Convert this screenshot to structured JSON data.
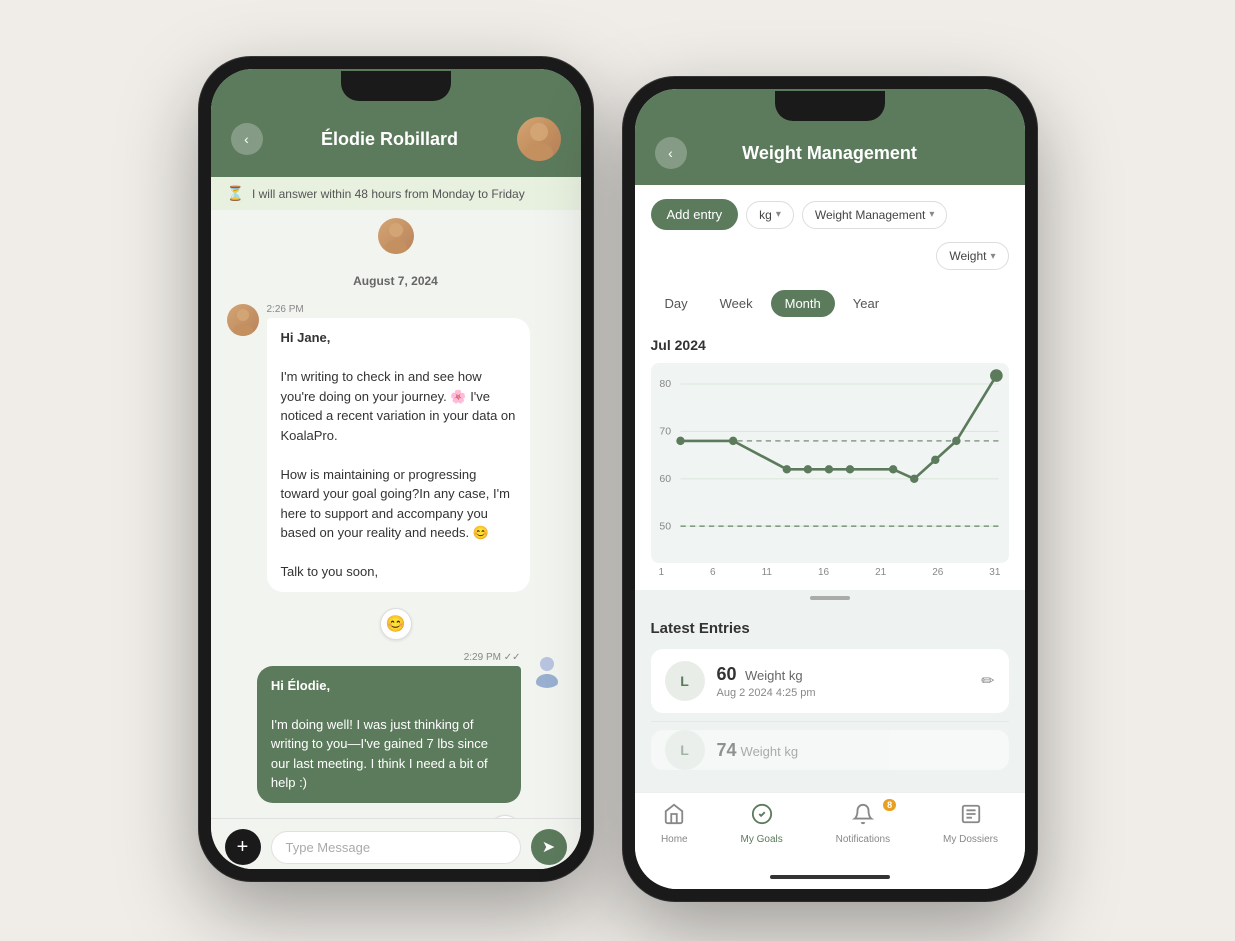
{
  "phone1": {
    "header": {
      "name": "Élodie Robillard",
      "back_label": "‹"
    },
    "status_bar": {
      "text": "I will answer within 48 hours from Monday to Friday"
    },
    "date_label": "August 7, 2024",
    "messages": [
      {
        "type": "received",
        "time": "2:26 PM",
        "text": "Hi Jane,\n\nI'm writing to check in and see how you're doing on your journey. 🌸 I've noticed a recent variation in your data on KoalaPro.\n\nHow is maintaining or progressing toward your goal going?In any case, I'm here to support and accompany you based on your reality and needs. 😊\n\nTalk to you soon,"
      },
      {
        "type": "sent",
        "time": "2:29 PM",
        "text": "Hi Élodie,\n\nI'm doing well! I was just thinking of writing to you—I've gained 7 lbs since our last meeting. I think I need a bit of help :)"
      }
    ],
    "input_placeholder": "Type Message",
    "add_button": "+",
    "send_button": "➤"
  },
  "phone2": {
    "header": {
      "title": "Weight Management",
      "back_label": "‹"
    },
    "controls": {
      "add_entry": "Add entry",
      "unit": "kg",
      "category": "Weight Management",
      "metric": "Weight"
    },
    "period_tabs": [
      "Day",
      "Week",
      "Month",
      "Year"
    ],
    "active_tab": "Month",
    "chart": {
      "period_label": "Jul 2024",
      "y_labels": [
        "80",
        "70",
        "60",
        "50"
      ],
      "x_labels": [
        "1",
        "6",
        "11",
        "16",
        "21",
        "26",
        "31"
      ],
      "data_points": [
        {
          "x": 1,
          "y": 70
        },
        {
          "x": 5,
          "y": 70
        },
        {
          "x": 10,
          "y": 62
        },
        {
          "x": 12,
          "y": 62
        },
        {
          "x": 14,
          "y": 62
        },
        {
          "x": 16,
          "y": 62
        },
        {
          "x": 20,
          "y": 62
        },
        {
          "x": 22,
          "y": 58
        },
        {
          "x": 24,
          "y": 64
        },
        {
          "x": 26,
          "y": 68
        },
        {
          "x": 30,
          "y": 82
        }
      ],
      "dashed_line_1": 68,
      "dashed_line_2": 50
    },
    "latest_entries": {
      "title": "Latest Entries",
      "entries": [
        {
          "value": "60",
          "unit": "Weight kg",
          "date": "Aug 2 2024 4:25 pm",
          "icon": "L"
        },
        {
          "value": "74",
          "unit": "Weight kg",
          "date": "",
          "icon": "L"
        }
      ]
    },
    "bottom_nav": [
      {
        "label": "Home",
        "icon": "🏠",
        "active": false
      },
      {
        "label": "My Goals",
        "icon": "✅",
        "active": true
      },
      {
        "label": "Notifications",
        "icon": "🔔",
        "active": false,
        "badge": "8"
      },
      {
        "label": "My Dossiers",
        "icon": "📋",
        "active": false
      }
    ]
  }
}
